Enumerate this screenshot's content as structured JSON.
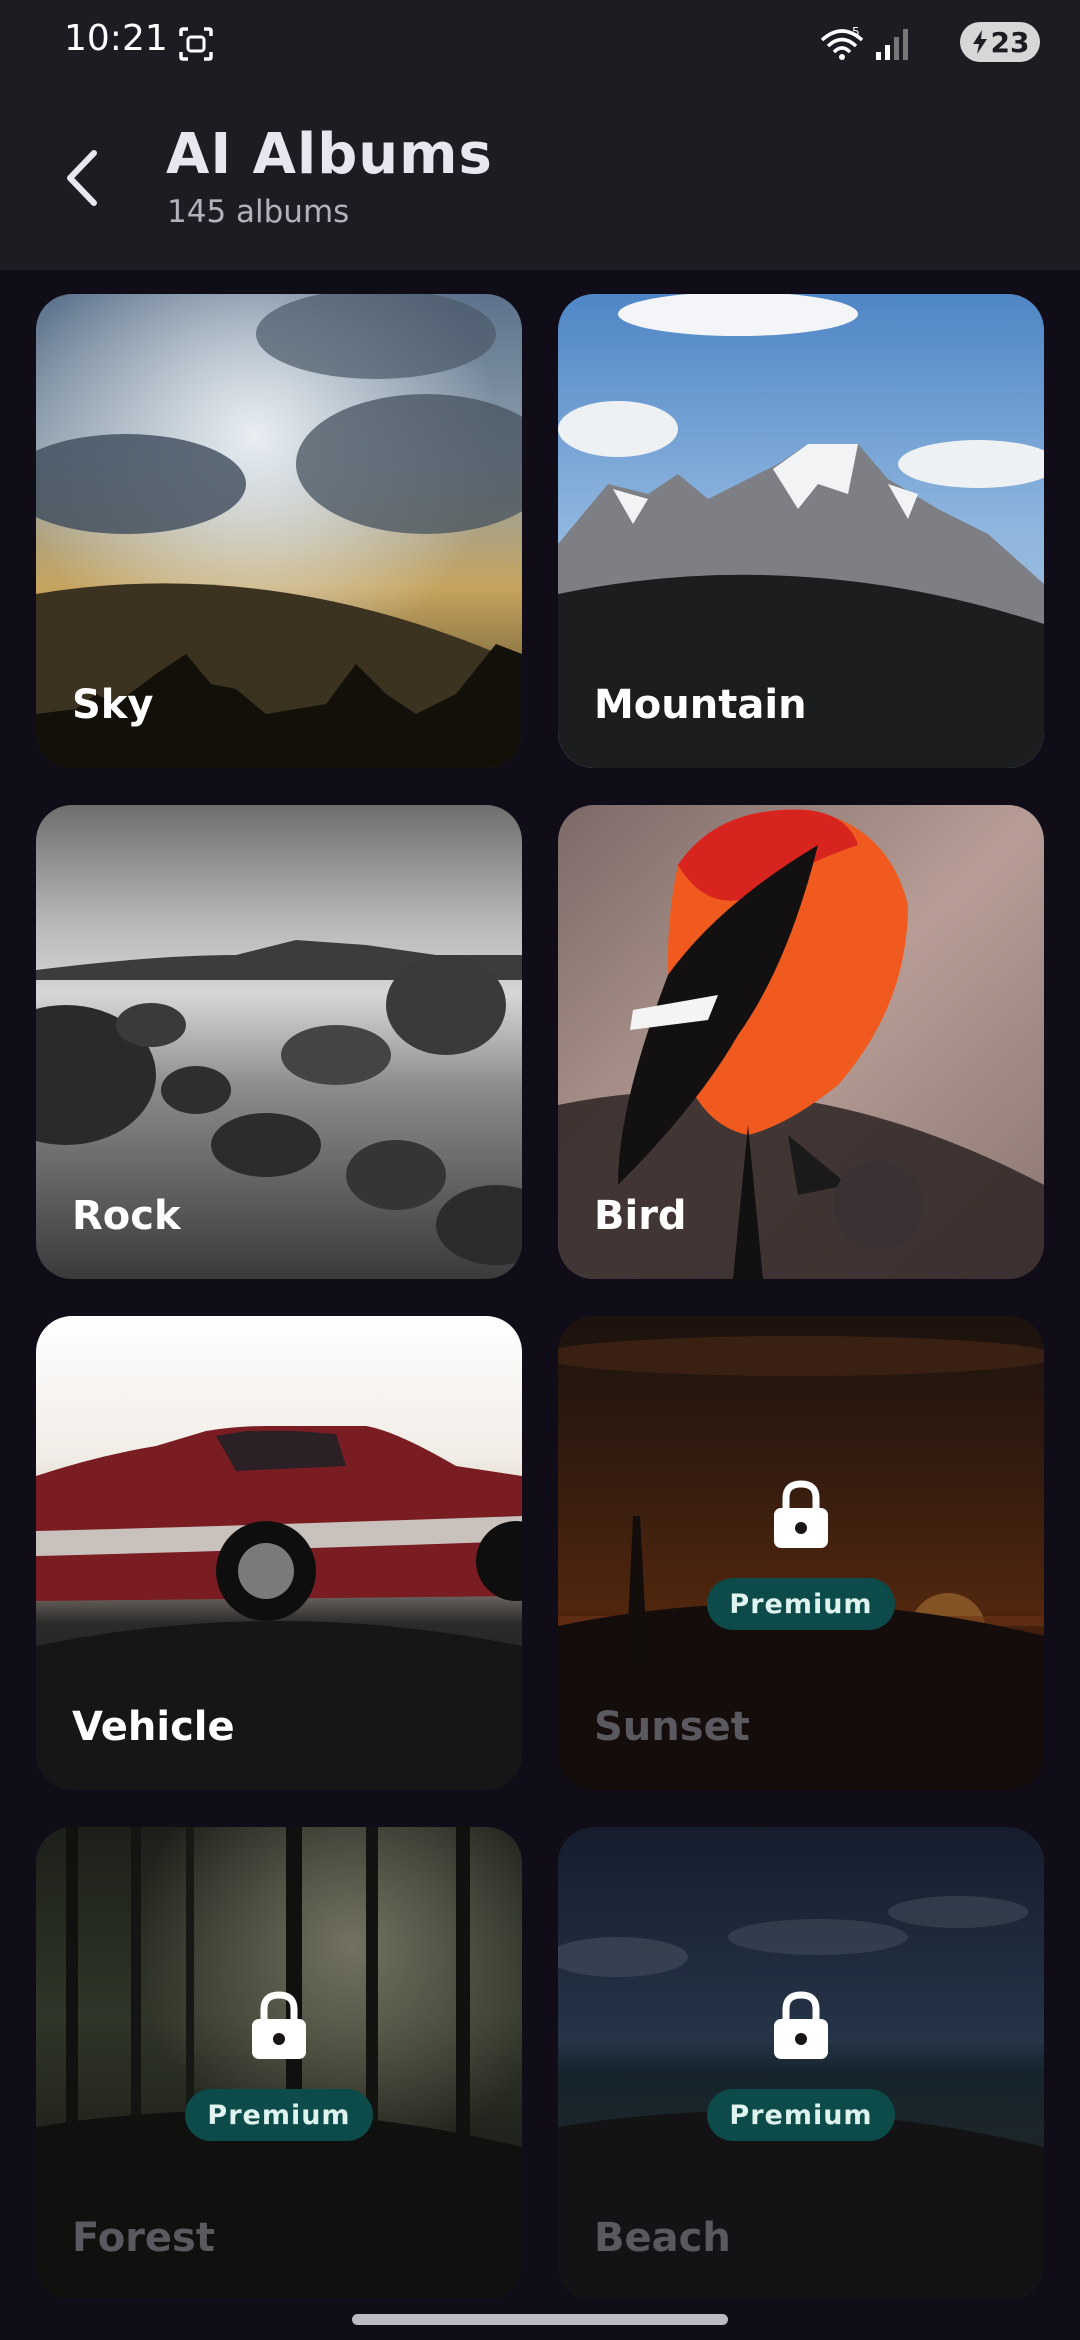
{
  "status_bar": {
    "time": "10:21",
    "screenshot_icon": "screenshot-icon",
    "wifi_icon": "wifi-icon",
    "signal_icon": "signal-icon",
    "battery_level": "23"
  },
  "header": {
    "title": "AI Albums",
    "subtitle": "145 albums",
    "back_icon": "back-arrow-icon"
  },
  "albums": [
    {
      "label": "Sky",
      "locked": false
    },
    {
      "label": "Mountain",
      "locked": false
    },
    {
      "label": "Rock",
      "locked": false
    },
    {
      "label": "Bird",
      "locked": false
    },
    {
      "label": "Vehicle",
      "locked": false
    },
    {
      "label": "Sunset",
      "locked": true,
      "badge": "Premium"
    },
    {
      "label": "Forest",
      "locked": true,
      "badge": "Premium"
    },
    {
      "label": "Beach",
      "locked": true,
      "badge": "Premium"
    }
  ],
  "colors": {
    "background": "#100d18",
    "appbar": "#1e1c23",
    "premium_badge": "#0c4b49",
    "locked_label": "#5b5960"
  }
}
